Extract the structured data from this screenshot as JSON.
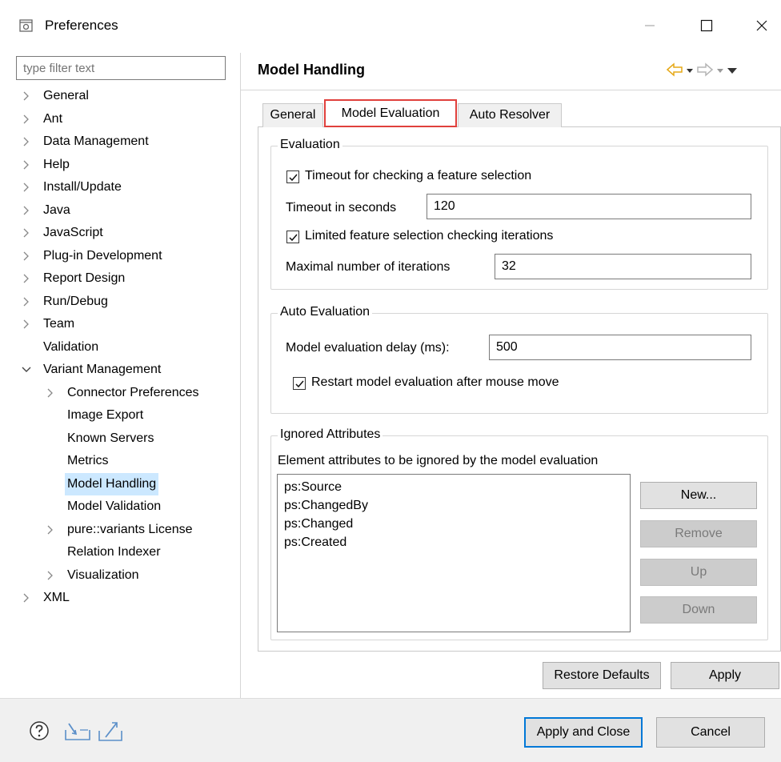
{
  "window": {
    "title": "Preferences",
    "minimize_icon": "minimize-icon",
    "maximize_icon": "maximize-icon",
    "close_icon": "close-icon"
  },
  "left": {
    "filter_placeholder": "type filter text",
    "tree": [
      {
        "label": "General",
        "expander": "collapsed",
        "level": 0
      },
      {
        "label": "Ant",
        "expander": "collapsed",
        "level": 0
      },
      {
        "label": "Data Management",
        "expander": "collapsed",
        "level": 0
      },
      {
        "label": "Help",
        "expander": "collapsed",
        "level": 0
      },
      {
        "label": "Install/Update",
        "expander": "collapsed",
        "level": 0
      },
      {
        "label": "Java",
        "expander": "collapsed",
        "level": 0
      },
      {
        "label": "JavaScript",
        "expander": "collapsed",
        "level": 0
      },
      {
        "label": "Plug-in Development",
        "expander": "collapsed",
        "level": 0
      },
      {
        "label": "Report Design",
        "expander": "collapsed",
        "level": 0
      },
      {
        "label": "Run/Debug",
        "expander": "collapsed",
        "level": 0
      },
      {
        "label": "Team",
        "expander": "collapsed",
        "level": 0
      },
      {
        "label": "Validation",
        "expander": "none",
        "level": 0
      },
      {
        "label": "Variant Management",
        "expander": "expanded",
        "level": 0
      },
      {
        "label": "Connector Preferences",
        "expander": "collapsed",
        "level": 1
      },
      {
        "label": "Image Export",
        "expander": "none",
        "level": 1
      },
      {
        "label": "Known Servers",
        "expander": "none",
        "level": 1
      },
      {
        "label": "Metrics",
        "expander": "none",
        "level": 1
      },
      {
        "label": "Model Handling",
        "expander": "none",
        "level": 1,
        "selected": true
      },
      {
        "label": "Model Validation",
        "expander": "none",
        "level": 1
      },
      {
        "label": "pure::variants License",
        "expander": "collapsed",
        "level": 1
      },
      {
        "label": "Relation Indexer",
        "expander": "none",
        "level": 1
      },
      {
        "label": "Visualization",
        "expander": "collapsed",
        "level": 1
      },
      {
        "label": "XML",
        "expander": "collapsed",
        "level": 0
      }
    ]
  },
  "page": {
    "title": "Model Handling",
    "tabs": [
      {
        "label": "General",
        "active": false
      },
      {
        "label": "Model Evaluation",
        "active": true
      },
      {
        "label": "Auto Resolver",
        "active": false
      }
    ],
    "evaluation": {
      "legend": "Evaluation",
      "timeout_check_label": "Timeout for checking a feature selection",
      "timeout_check": true,
      "timeout_seconds_label": "Timeout in seconds",
      "timeout_seconds_value": "120",
      "limited_check_label": "Limited feature selection checking iterations",
      "limited_check": true,
      "max_iterations_label": "Maximal number of iterations",
      "max_iterations_value": "32"
    },
    "auto_evaluation": {
      "legend": "Auto Evaluation",
      "delay_label": "Model evaluation delay (ms):",
      "delay_value": "500",
      "restart_label": "Restart model evaluation after mouse move",
      "restart_check": true
    },
    "ignored": {
      "legend": "Ignored Attributes",
      "description": "Element attributes to be ignored by the model evaluation",
      "items": [
        "ps:Source",
        "ps:ChangedBy",
        "ps:Changed",
        "ps:Created"
      ],
      "new_button": "New...",
      "remove_button": "Remove",
      "up_button": "Up",
      "down_button": "Down"
    },
    "restore_defaults": "Restore Defaults",
    "apply": "Apply"
  },
  "footer": {
    "apply_close": "Apply and Close",
    "cancel": "Cancel"
  },
  "colors": {
    "selection": "#cce8ff",
    "tab_highlight": "#e0403c",
    "primary_border": "#0078d7",
    "nav_back": "#e6a817"
  }
}
